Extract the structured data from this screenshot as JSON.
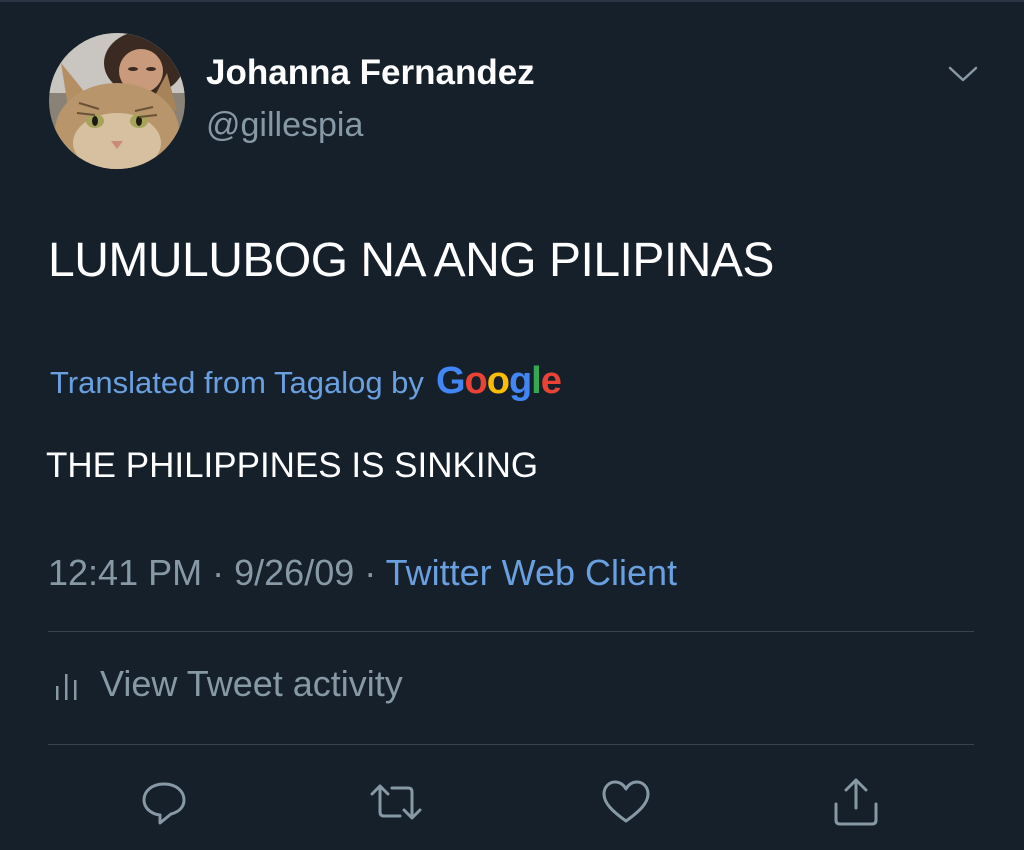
{
  "tweet": {
    "author": {
      "display_name": "Johanna Fernandez",
      "handle": "@gillespia"
    },
    "text": "LUMULUBOG NA ANG PILIPINAS",
    "translation": {
      "label": "Translated from Tagalog by",
      "provider_letters": [
        "G",
        "o",
        "o",
        "g",
        "l",
        "e"
      ],
      "provider_colors": [
        "#4285f4",
        "#ea4335",
        "#fbbc05",
        "#4285f4",
        "#34a853",
        "#ea4335"
      ],
      "text": "THE PHILIPPINES IS SINKING"
    },
    "meta": {
      "time": "12:41 PM",
      "separator": "·",
      "date": "9/26/09",
      "source": "Twitter Web Client"
    },
    "activity_label": "View Tweet activity"
  },
  "icons": {
    "more": "chevron-down-icon",
    "activity": "bar-chart-icon",
    "actions": [
      "reply-icon",
      "retweet-icon",
      "like-icon",
      "share-icon"
    ]
  },
  "colors": {
    "background": "#15202b",
    "text_primary": "#ffffff",
    "text_secondary": "#8899a6",
    "link": "#6ba0e0",
    "divider": "#38444d"
  }
}
